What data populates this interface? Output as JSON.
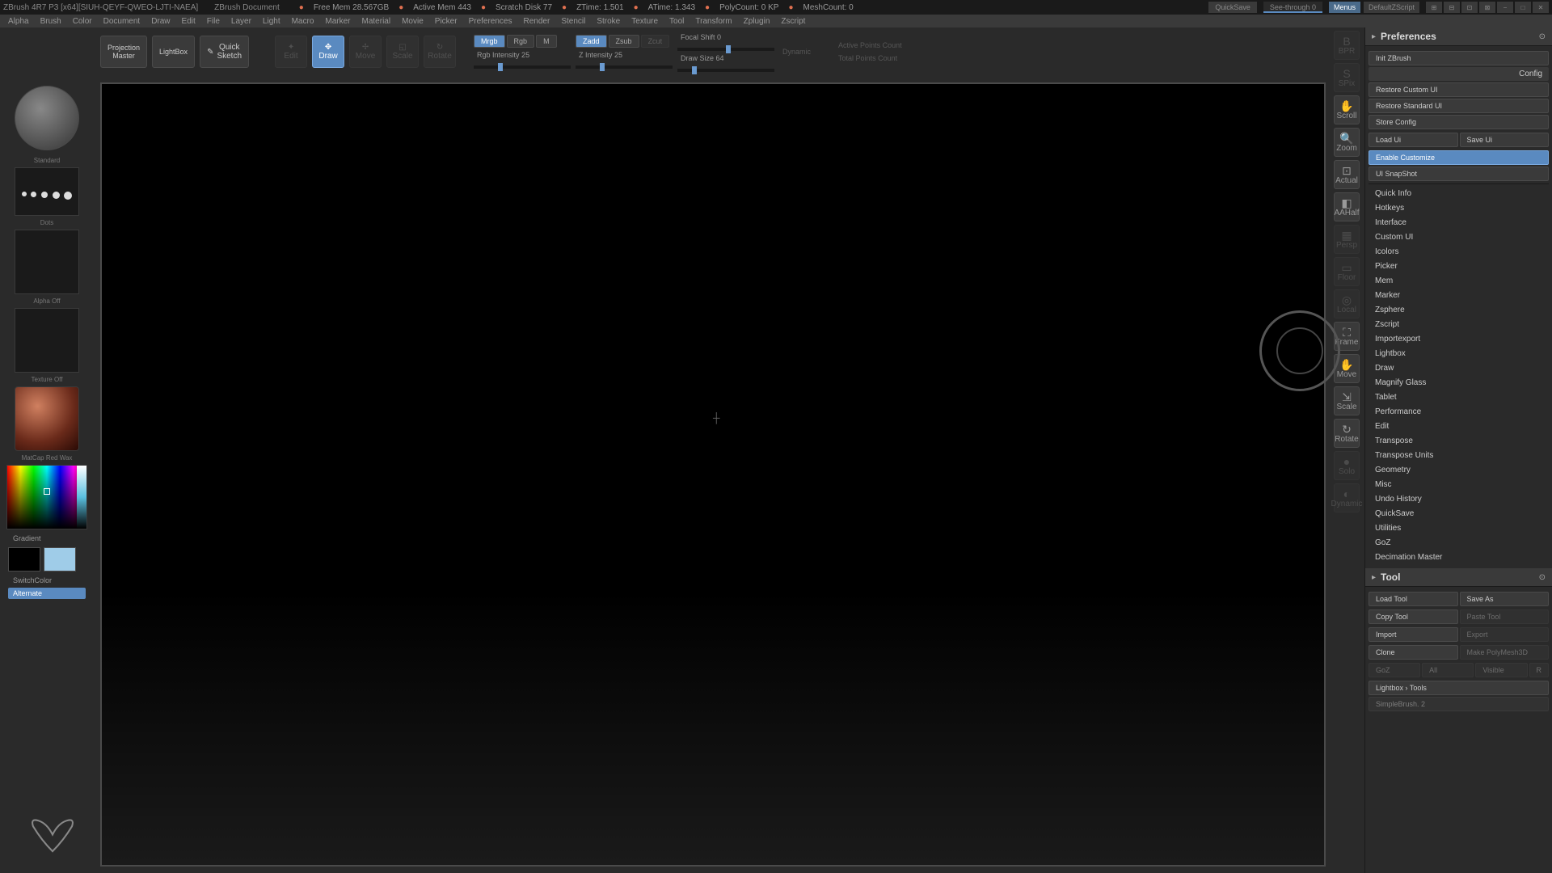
{
  "title": {
    "app": "ZBrush 4R7 P3 [x64][SIUH-QEYF-QWEO-LJTI-NAEA]",
    "doc": "ZBrush Document"
  },
  "stats": {
    "freemem": "Free Mem 28.567GB",
    "activemem": "Active Mem 443",
    "scratch": "Scratch Disk 77",
    "ztime": "ZTime: 1.501",
    "atime": "ATime: 1.343",
    "polycount": "PolyCount: 0 KP",
    "meshcount": "MeshCount: 0"
  },
  "titlebar_buttons": {
    "quicksave": "QuickSave",
    "seethrough": "See-through   0",
    "menus": "Menus",
    "script": "DefaultZScript"
  },
  "menus": [
    "Alpha",
    "Brush",
    "Color",
    "Document",
    "Draw",
    "Edit",
    "File",
    "Layer",
    "Light",
    "Macro",
    "Marker",
    "Material",
    "Movie",
    "Picker",
    "Preferences",
    "Render",
    "Stencil",
    "Stroke",
    "Texture",
    "Tool",
    "Transform",
    "Zplugin",
    "Zscript"
  ],
  "shelf": {
    "projection": "Projection\nMaster",
    "lightbox": "LightBox",
    "quicksketch": "Quick\nSketch",
    "edit": "Edit",
    "draw": "Draw",
    "move": "Move",
    "scale": "Scale",
    "rotate": "Rotate",
    "mrgb": "Mrgb",
    "rgb": "Rgb",
    "m": "M",
    "rgbintensity": "Rgb Intensity 25",
    "zadd": "Zadd",
    "zsub": "Zsub",
    "zcut": "Zcut",
    "zintensity": "Z Intensity 25",
    "focalshift": "Focal Shift 0",
    "drawsize": "Draw Size 64",
    "dynamic": "Dynamic",
    "activepoints": "Active Points Count",
    "totalpoints": "Total Points Count"
  },
  "left": {
    "brush_label": "Standard",
    "stroke_label": "Dots",
    "alpha_label": "Alpha Off",
    "texture_label": "Texture Off",
    "material_label": "MatCap Red Wax",
    "gradient": "Gradient",
    "switchcolor": "SwitchColor",
    "alternate": "Alternate"
  },
  "swatches": {
    "main": "#000000",
    "secondary": "#9fcce8"
  },
  "right_icons": [
    "BPR",
    "SPix",
    "Scroll",
    "Zoom",
    "Actual",
    "AAHalf",
    "Persp",
    "Floor",
    "Local",
    "Frame",
    "Move",
    "Scale",
    "Rotate",
    "Solo",
    "Dynamic"
  ],
  "prefs": {
    "title": "Preferences",
    "init": "Init ZBrush",
    "config": "Config",
    "restore_custom": "Restore Custom UI",
    "restore_standard": "Restore Standard UI",
    "store_config": "Store Config",
    "load_ui": "Load Ui",
    "save_ui": "Save Ui",
    "enable_customize": "Enable Customize",
    "ui_snapshot": "UI SnapShot",
    "sections": [
      "Quick Info",
      "Hotkeys",
      "Interface",
      "Custom UI",
      "Icolors",
      "Picker",
      "Mem",
      "Marker",
      "Zsphere",
      "Zscript",
      "Importexport",
      "Lightbox",
      "Draw",
      "Magnify Glass",
      "Tablet",
      "Performance",
      "Edit",
      "Transpose",
      "Transpose Units",
      "Geometry",
      "Misc",
      "Undo History",
      "QuickSave",
      "Utilities",
      "GoZ",
      "Decimation Master"
    ]
  },
  "tool": {
    "title": "Tool",
    "load": "Load Tool",
    "saveas": "Save As",
    "copy": "Copy Tool",
    "paste": "Paste Tool",
    "import": "Import",
    "export": "Export",
    "clone": "Clone",
    "makepolymesh": "Make PolyMesh3D",
    "goz": "GoZ",
    "all": "All",
    "visible": "Visible",
    "r": "R",
    "lightbox_tools": "Lightbox › Tools",
    "current": "SimpleBrush. 2"
  }
}
